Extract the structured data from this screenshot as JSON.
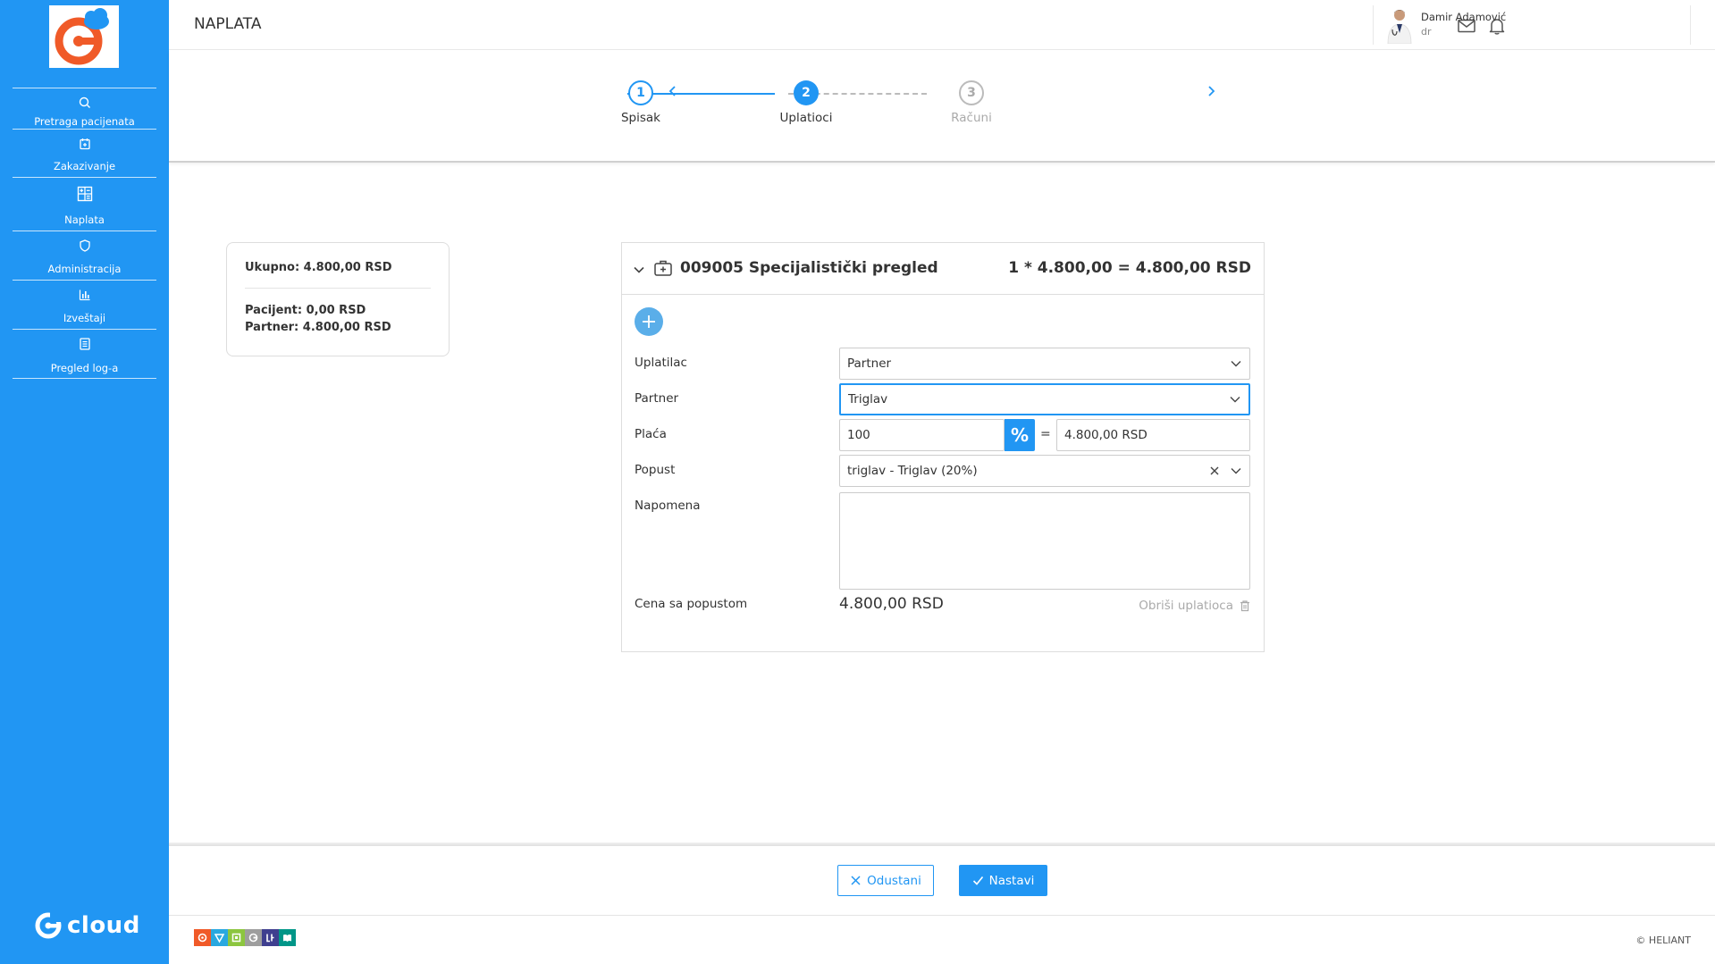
{
  "sidebar": {
    "items": [
      {
        "label": "Pretraga pacijenata",
        "icon": "search-icon"
      },
      {
        "label": "Zakazivanje",
        "icon": "calendar-icon"
      },
      {
        "label": "Naplata",
        "icon": "calculator-icon"
      },
      {
        "label": "Administracija",
        "icon": "shield-icon"
      },
      {
        "label": "Izveštaji",
        "icon": "bar-chart-icon"
      },
      {
        "label": "Pregled log-a",
        "icon": "log-icon"
      }
    ],
    "brand": "cloud"
  },
  "header": {
    "title": "NAPLATA",
    "user": {
      "name": "Damir Adamović",
      "role": "dr"
    }
  },
  "stepper": {
    "steps": [
      {
        "number": "1",
        "label": "Spisak",
        "state": "done"
      },
      {
        "number": "2",
        "label": "Uplatioci",
        "state": "active"
      },
      {
        "number": "3",
        "label": "Računi",
        "state": "pending"
      }
    ]
  },
  "summary": {
    "total": "Ukupno: 4.800,00 RSD",
    "patient": "Pacijent: 0,00 RSD",
    "partner": "Partner: 4.800,00 RSD"
  },
  "service": {
    "title": "009005 Specijalistički pregled",
    "calc": "1 * 4.800,00 = 4.800,00 RSD"
  },
  "form": {
    "payer_label": "Uplatilac",
    "payer_value": "Partner",
    "partner_label": "Partner",
    "partner_value": "Triglav",
    "pays_label": "Plaća",
    "pays_percent": "100",
    "pays_percent_symbol": "%",
    "equals": "=",
    "pays_amount": "4.800,00 RSD",
    "discount_label": "Popust",
    "discount_value": "triglav - Triglav (20%)",
    "note_label": "Napomena",
    "note_value": "",
    "price_label": "Cena sa popustom",
    "price_value": "4.800,00 RSD",
    "delete_label": "Obriši uplatioca"
  },
  "footer": {
    "cancel_label": "Odustani",
    "continue_label": "Nastavi",
    "copyright": "© HELIANT"
  },
  "colors": {
    "primary": "#2196f3",
    "add_button": "#5aaee9",
    "logo_orange": "#f05a28"
  }
}
